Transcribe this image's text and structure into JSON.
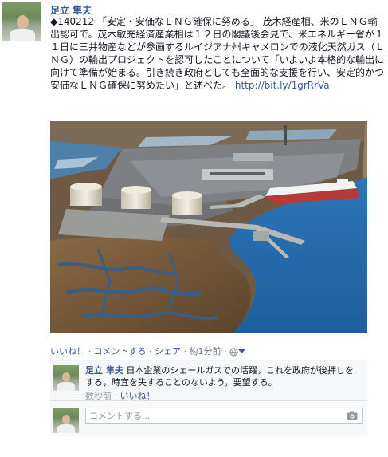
{
  "post": {
    "author": "足立 隼夫",
    "text_lines": [
      "◆140212 「安定・安価なＬＮＧ確保に努める」 茂木経産相、米のＬＮ",
      "Ｇ輸出認可で。茂木敏充経済産業相は１２日の閣議後会見で、米エネル",
      "ギー省が１１日に三井物産などが参画するルイジアナ州キャメロンでの",
      "液化天然ガス（ＬＮＧ）の輸出プロジェクトを認可したことについて",
      "「いよいよ本格的な輸出に向けて準備が始まる。引き続き政府としても",
      "全面的な支援を行い、安定的かつ安価なＬＮＧ確保に努めたい」と述べ"
    ],
    "text_last": "た。",
    "link": "http://bit.ly/1grRrVa",
    "photo_icon": "lng-terminal-aerial-photo"
  },
  "actions": {
    "like": "いいね！",
    "sep1": " · ",
    "comment": "コメントする",
    "sep2": " · ",
    "share": "シェア",
    "sep3": " · ",
    "time": "約1分前",
    "sep4": " · ",
    "privacy_icon": "globe-icon"
  },
  "comment": {
    "author": "足立 隼夫",
    "text": " 日本企業のシェールガスでの活躍，これを政府が後押しをする，時宜を失することのないよう，要望する。",
    "time": "数秒前",
    "sep": " · ",
    "like": "いいね！"
  },
  "composer": {
    "placeholder": "コメントする...",
    "camera_icon": "camera-icon"
  }
}
